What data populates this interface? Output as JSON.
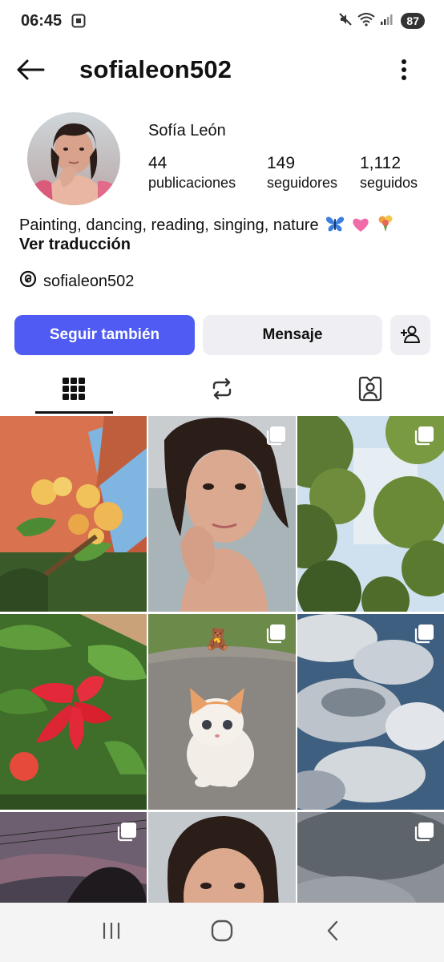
{
  "status_bar": {
    "time": "06:45",
    "battery": "87",
    "icons": [
      "screenshot-icon",
      "mute-icon",
      "wifi-icon",
      "signal-icon"
    ]
  },
  "header": {
    "username": "sofialeon502",
    "back_icon": "arrow-left-icon",
    "menu_icon": "more-vertical-icon"
  },
  "profile": {
    "name": "Sofía León",
    "stats": [
      {
        "value": "44",
        "label": "publicaciones"
      },
      {
        "value": "149",
        "label": "seguidores"
      },
      {
        "value": "1,112",
        "label": "seguidos"
      }
    ],
    "bio": "Painting, dancing, reading, singing, nature",
    "bio_emojis": [
      "butterfly",
      "pink-heart",
      "bouquet"
    ],
    "translate_label": "Ver traducción",
    "threads_handle": "sofialeon502"
  },
  "actions": {
    "follow_label": "Seguir también",
    "message_label": "Mensaje",
    "add_user_icon": "add-user-icon"
  },
  "tabs": [
    {
      "icon": "grid-icon",
      "active": true
    },
    {
      "icon": "repost-icon",
      "active": false
    },
    {
      "icon": "tagged-icon",
      "active": false
    }
  ],
  "grid_posts": [
    {
      "subject": "orange-flowers",
      "multi": false
    },
    {
      "subject": "selfie",
      "multi": true
    },
    {
      "subject": "tree-canopy",
      "multi": true
    },
    {
      "subject": "red-hibiscus",
      "multi": false
    },
    {
      "subject": "orange-kitten",
      "multi": true
    },
    {
      "subject": "clouds",
      "multi": true
    },
    {
      "subject": "dusk-sky",
      "multi": true
    },
    {
      "subject": "selfie-2",
      "multi": false
    },
    {
      "subject": "grey-sky",
      "multi": true
    }
  ],
  "colors": {
    "accent": "#4f5bf2",
    "secondary_button": "#efeff3",
    "text": "#111111"
  }
}
